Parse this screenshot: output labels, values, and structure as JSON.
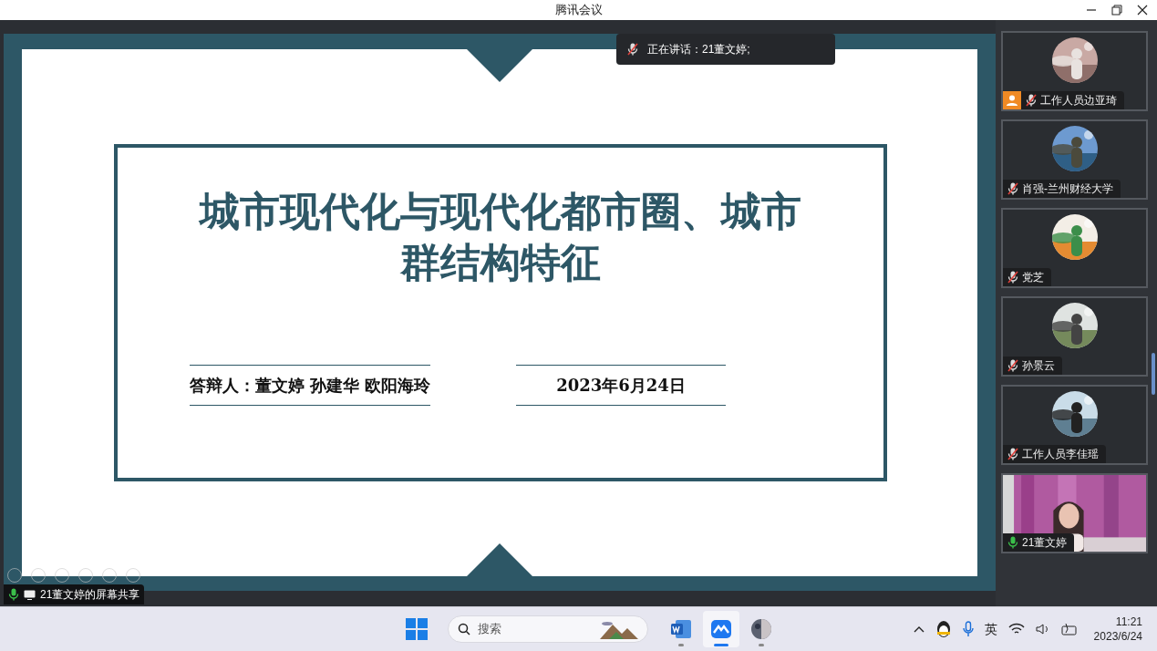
{
  "window": {
    "title": "腾讯会议"
  },
  "speaking": {
    "label": "正在讲话：21董文婷;"
  },
  "slide": {
    "title": "城市现代化与现代化都市圈、城市群结构特征",
    "presenters": "答辩人：董文婷 孙建华 欧阳海玲",
    "date": "2023年6月24日"
  },
  "share_label": {
    "text": "21董文婷的屏幕共享",
    "muted": false
  },
  "participants": [
    {
      "name": "工作人员边亚琦",
      "muted": true,
      "host": true,
      "kind": "avatar"
    },
    {
      "name": "肖强-兰州财经大学",
      "muted": true,
      "host": false,
      "kind": "avatar"
    },
    {
      "name": "党芝",
      "muted": true,
      "host": false,
      "kind": "avatar"
    },
    {
      "name": "孙景云",
      "muted": true,
      "host": false,
      "kind": "avatar"
    },
    {
      "name": "工作人员李佳瑶",
      "muted": true,
      "host": false,
      "kind": "avatar"
    },
    {
      "name": "21董文婷",
      "muted": false,
      "host": false,
      "kind": "video"
    }
  ],
  "taskbar": {
    "search_placeholder": "搜索",
    "apps": [
      {
        "kind": "word",
        "selected": false
      },
      {
        "kind": "meeting",
        "selected": true
      },
      {
        "kind": "browser",
        "selected": false
      }
    ],
    "input_method": "英",
    "time": "11:21",
    "date": "2023/6/24"
  }
}
